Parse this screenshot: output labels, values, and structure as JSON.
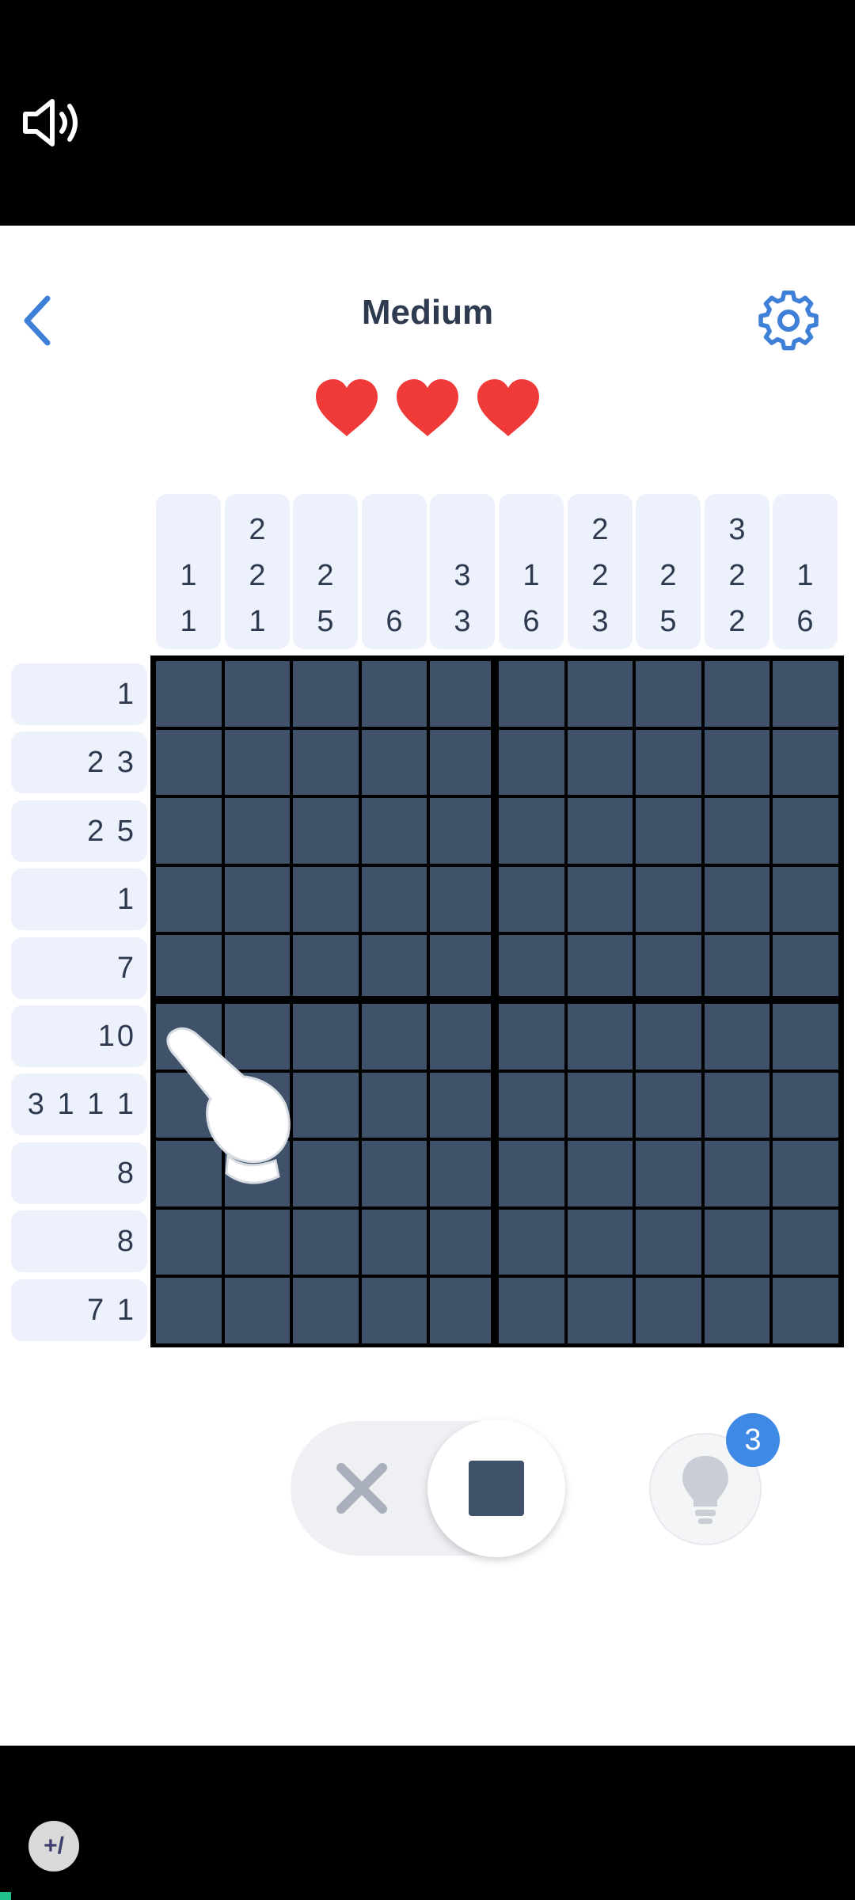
{
  "header": {
    "title": "Medium",
    "back_icon": "chevron-left-icon",
    "settings_icon": "gear-icon"
  },
  "lives": {
    "count": 3,
    "color": "#f03a3a"
  },
  "puzzle": {
    "column_clues": [
      [
        "1",
        "1"
      ],
      [
        "2",
        "2",
        "1"
      ],
      [
        "2",
        "5"
      ],
      [
        "6"
      ],
      [
        "3",
        "3"
      ],
      [
        "1",
        "6"
      ],
      [
        "2",
        "2",
        "3"
      ],
      [
        "2",
        "5"
      ],
      [
        "3",
        "2",
        "2"
      ],
      [
        "1",
        "6"
      ]
    ],
    "row_clues": [
      "1",
      "2 3",
      "2 5",
      "1",
      "7",
      "10",
      "3 1 1 1",
      "8",
      "8",
      "7 1"
    ],
    "rows": 10,
    "cols": 10,
    "cell_color": "#3f5269"
  },
  "controls": {
    "mode_cross_icon": "x-icon",
    "mode_fill_icon": "filled-square-icon",
    "hint_icon": "lightbulb-icon",
    "hint_count": "3"
  },
  "overlay": {
    "pointer_icon": "hand-pointer-icon",
    "speaker_icon": "speaker-icon"
  },
  "colors": {
    "accent": "#3e88e6",
    "text": "#2e3a4f",
    "clue_bg": "#edf1fb"
  }
}
